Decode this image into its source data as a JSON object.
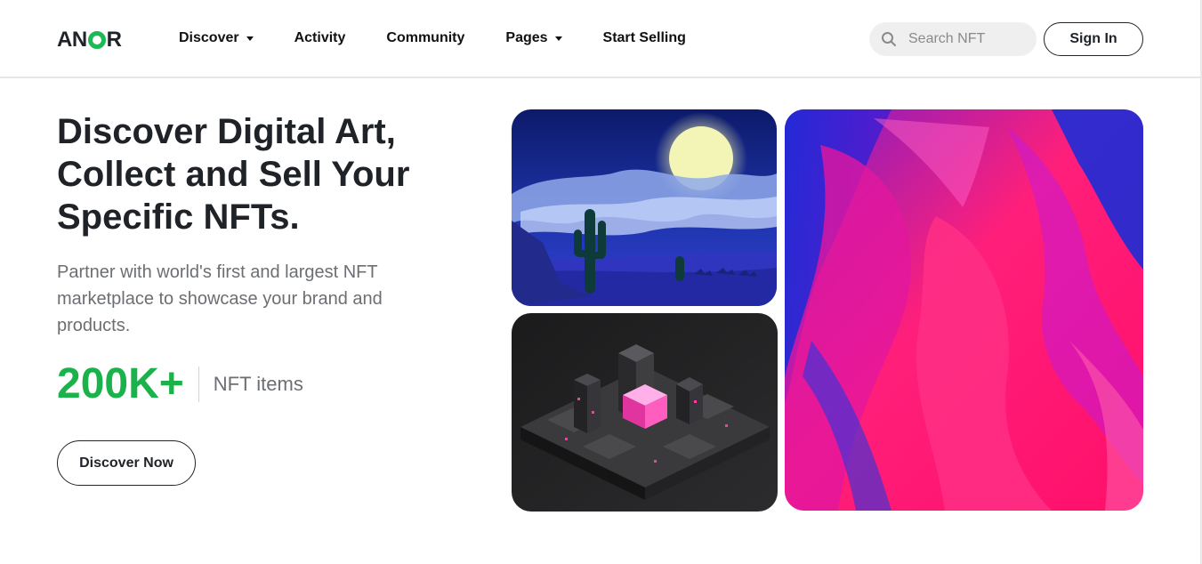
{
  "brand": {
    "logo_text_left": "AN",
    "logo_text_right": "R",
    "accent_color": "#1bb24b"
  },
  "nav": {
    "items": [
      {
        "label": "Discover",
        "has_dropdown": true
      },
      {
        "label": "Activity",
        "has_dropdown": false
      },
      {
        "label": "Community",
        "has_dropdown": false
      },
      {
        "label": "Pages",
        "has_dropdown": true
      },
      {
        "label": "Start Selling",
        "has_dropdown": false
      }
    ]
  },
  "search": {
    "placeholder": "Search NFT",
    "icon": "search-icon"
  },
  "header": {
    "signin_label": "Sign In"
  },
  "hero": {
    "title_lines": [
      "Discover Digital Art,",
      "Collect and Sell Your",
      "Specific NFTs."
    ],
    "subtitle": "Partner with world's first and largest NFT marketplace to showcase your brand and products.",
    "stat_value": "200K+",
    "stat_label": "NFT items",
    "cta_label": "Discover Now"
  },
  "gallery": {
    "images": [
      {
        "name": "desert-moon-artwork"
      },
      {
        "name": "isometric-city-artwork"
      },
      {
        "name": "abstract-paint-artwork"
      }
    ]
  }
}
